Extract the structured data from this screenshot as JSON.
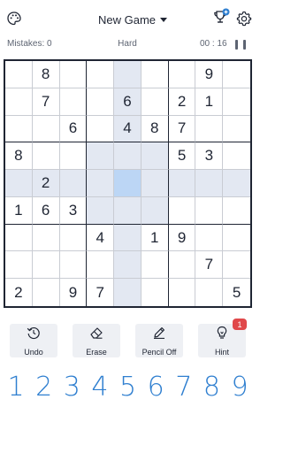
{
  "header": {
    "title": "New Game",
    "icons": {
      "left": "palette-icon",
      "trophy": "trophy-icon",
      "settings": "gear-icon"
    }
  },
  "status": {
    "mistakes": "Mistakes: 0",
    "difficulty": "Hard",
    "timer": "00 : 16"
  },
  "board": {
    "grid": [
      [
        "",
        "8",
        "",
        "",
        "",
        "",
        "",
        "9",
        ""
      ],
      [
        "",
        "7",
        "",
        "",
        "6",
        "",
        "2",
        "1",
        ""
      ],
      [
        "",
        "",
        "6",
        "",
        "4",
        "8",
        "7",
        "",
        ""
      ],
      [
        "8",
        "",
        "",
        "",
        "",
        "",
        "5",
        "3",
        ""
      ],
      [
        "",
        "2",
        "",
        "",
        "",
        "",
        "",
        "",
        ""
      ],
      [
        "1",
        "6",
        "3",
        "",
        "",
        "",
        "",
        "",
        ""
      ],
      [
        "",
        "",
        "",
        "4",
        "",
        "1",
        "9",
        "",
        ""
      ],
      [
        "",
        "",
        "",
        "",
        "",
        "",
        "",
        "7",
        ""
      ],
      [
        "2",
        "",
        "9",
        "7",
        "",
        "",
        "",
        "",
        "5"
      ]
    ],
    "selected": {
      "row": 4,
      "col": 4
    }
  },
  "tools": [
    {
      "label": "Undo",
      "icon": "undo-icon"
    },
    {
      "label": "Erase",
      "icon": "eraser-icon"
    },
    {
      "label": "Pencil Off",
      "icon": "pencil-icon"
    },
    {
      "label": "Hint",
      "icon": "lightbulb-icon"
    }
  ],
  "hint_badge": "1",
  "numpad": [
    "1",
    "2",
    "3",
    "4",
    "5",
    "6",
    "7",
    "8",
    "9"
  ],
  "colors": {
    "accent": "#2f7fd0",
    "highlight": "#e3e8f2",
    "selected": "#bcd6f5",
    "badge": "#e0484a"
  }
}
